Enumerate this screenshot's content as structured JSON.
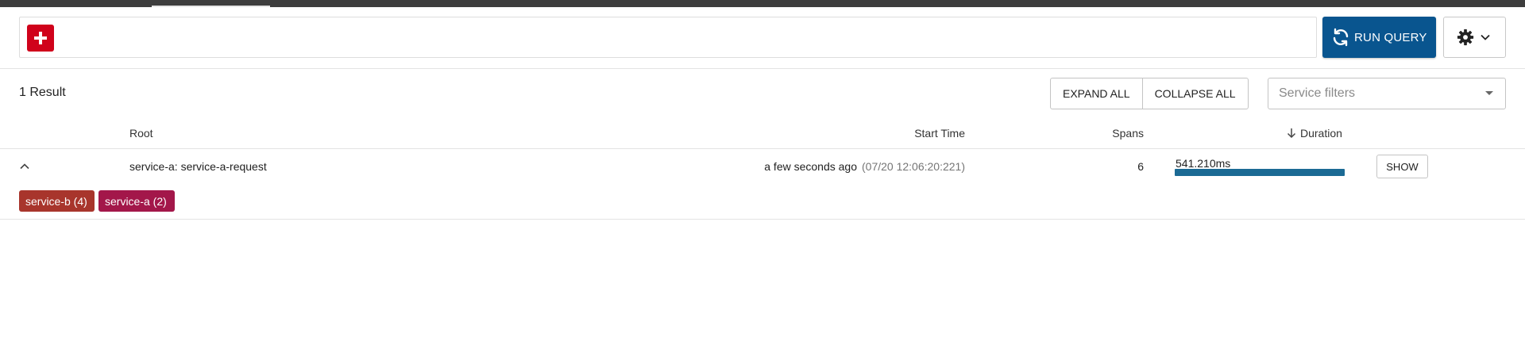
{
  "toolbar": {
    "run_query_label": "RUN QUERY",
    "add_icon": "plus-icon",
    "run_icon": "refresh-icon",
    "settings_icon": "gear-icon"
  },
  "results": {
    "count_label": "1 Result",
    "expand_all_label": "EXPAND ALL",
    "collapse_all_label": "COLLAPSE ALL",
    "service_filters_placeholder": "Service filters"
  },
  "table": {
    "columns": {
      "root": "Root",
      "start_time": "Start Time",
      "spans": "Spans",
      "duration": "Duration"
    },
    "duration_sort": "descending",
    "rows": [
      {
        "root": "service-a: service-a-request",
        "start_relative": "a few seconds ago",
        "start_absolute": "(07/20 12:06:20:221)",
        "spans": "6",
        "duration": "541.210ms",
        "duration_fraction": 1.0,
        "show_label": "SHOW",
        "services": [
          {
            "label": "service-b (4)",
            "color": "#a8352c"
          },
          {
            "label": "service-a (2)",
            "color": "#a3174a"
          }
        ]
      }
    ]
  },
  "colors": {
    "accent": "#09558f",
    "add_button": "#d0021b",
    "duration_bar": "#1b6a94",
    "topbar": "#3d3d3d"
  }
}
